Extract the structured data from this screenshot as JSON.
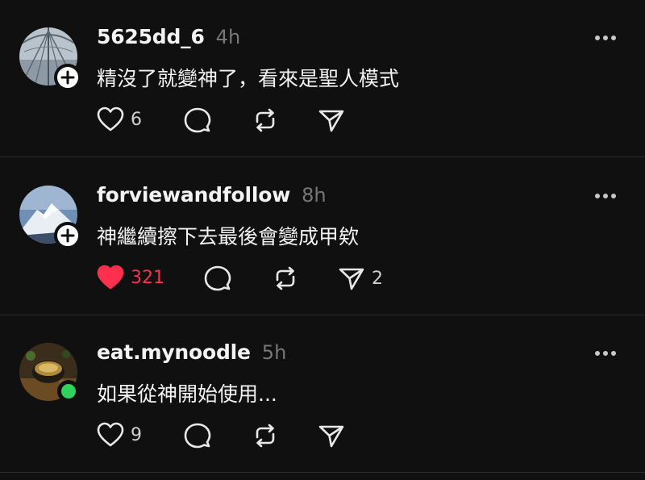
{
  "posts": [
    {
      "username": "5625dd_6",
      "time": "4h",
      "text": "精沒了就變神了，看來是聖人模式",
      "avatar_icon": "umbrella-photo",
      "avatar_badge": "follow-plus",
      "likes": "6",
      "liked": false,
      "shares": ""
    },
    {
      "username": "forviewandfollow",
      "time": "8h",
      "text": "神繼續擦下去最後會變成甲欸",
      "avatar_icon": "mountain-photo",
      "avatar_badge": "follow-plus",
      "likes": "321",
      "liked": true,
      "shares": "2"
    },
    {
      "username": "eat.mynoodle",
      "time": "5h",
      "text": "如果從神開始使用...",
      "avatar_icon": "food-photo",
      "avatar_badge": "online-dot",
      "likes": "9",
      "liked": false,
      "shares": ""
    }
  ],
  "colors": {
    "background": "#101010",
    "text": "#f3f3f3",
    "muted": "#777777",
    "like_active": "#ff2f4e",
    "online": "#2fd25a"
  }
}
